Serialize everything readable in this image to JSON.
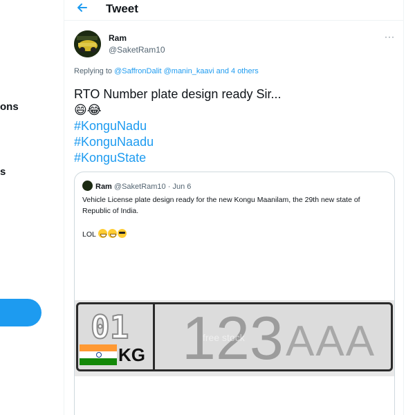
{
  "sidebar": {
    "fragment_1": "ons",
    "fragment_2": "s"
  },
  "header": {
    "title": "Tweet"
  },
  "tweet": {
    "author_name": "Ram",
    "author_handle": "@SaketRam10",
    "more": "···",
    "replying_prefix": "Replying to ",
    "reply_mentions": [
      "@SaffronDalit",
      "@manin_kaavi"
    ],
    "reply_others": "and 4 others",
    "text": "RTO Number plate design ready Sir...",
    "emojis": "😄😂",
    "hashtags": [
      "#KonguNadu",
      "#KonguNaadu",
      "#KonguState"
    ]
  },
  "quote": {
    "author_name": "Ram",
    "author_handle": "@SaketRam10",
    "separator": "·",
    "date": "Jun 6",
    "body": "Vehicle License plate design ready for the new Kongu Maanilam, the 29th new state of Republic of India.",
    "lol": "LOL",
    "plate": {
      "code": "01",
      "state": "KG",
      "number": "123",
      "letters": "AAA",
      "watermark": "free stock"
    }
  },
  "colors": {
    "accent": "#1d9bf0",
    "text": "#0f1419",
    "muted": "#536471",
    "border": "#cfd9de"
  }
}
